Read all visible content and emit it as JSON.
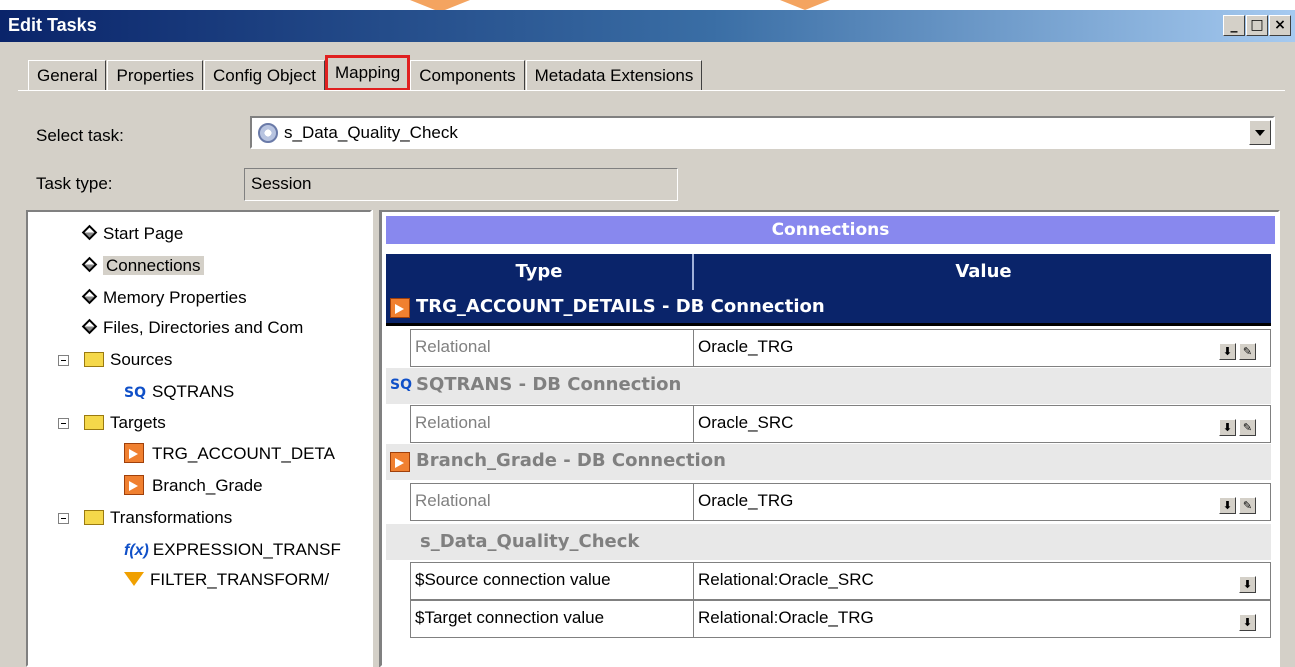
{
  "window": {
    "title": "Edit Tasks",
    "minimize": "_",
    "maximize": "□",
    "close": "×"
  },
  "tabs": [
    "General",
    "Properties",
    "Config Object",
    "Mapping",
    "Components",
    "Metadata Extensions"
  ],
  "active_tab": "Mapping",
  "select_task": {
    "label": "Select task:",
    "value": "s_Data_Quality_Check"
  },
  "task_type": {
    "label": "Task type:",
    "value": "Session"
  },
  "tree": {
    "start_page": "Start Page",
    "connections": "Connections",
    "memory_properties": "Memory Properties",
    "files": "Files, Directories and Com",
    "sources": "Sources",
    "sqtrans": "SQTRANS",
    "targets": "Targets",
    "trg_account": "TRG_ACCOUNT_DETA",
    "branch_grade": "Branch_Grade",
    "transformations": "Transformations",
    "expression": "EXPRESSION_TRANSF",
    "filter": "FILTER_TRANSFORM/"
  },
  "connections": {
    "header": "Connections",
    "col_type": "Type",
    "col_value": "Value",
    "groups": [
      {
        "title": "TRG_ACCOUNT_DETAILS - DB Connection",
        "type": "Relational",
        "value": "Oracle_TRG"
      },
      {
        "title": "SQTRANS - DB Connection",
        "type": "Relational",
        "value": "Oracle_SRC"
      },
      {
        "title": "Branch_Grade - DB Connection",
        "type": "Relational",
        "value": "Oracle_TRG"
      }
    ],
    "session_group": "s_Data_Quality_Check",
    "session_rows": [
      {
        "type": "$Source connection value",
        "value": "Relational:Oracle_SRC"
      },
      {
        "type": "$Target connection value",
        "value": "Relational:Oracle_TRG"
      }
    ]
  }
}
